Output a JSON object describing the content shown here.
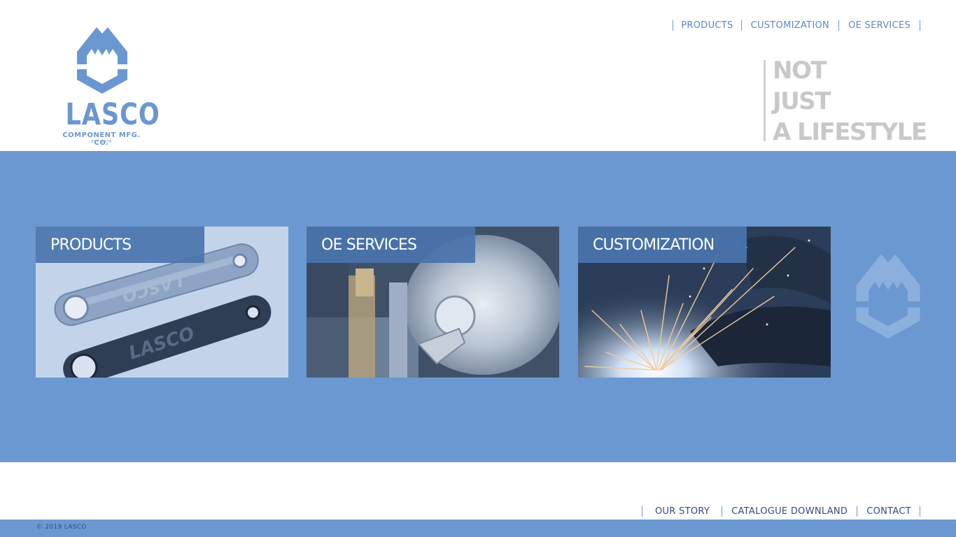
{
  "brand": {
    "name": "LASCO",
    "subtitle": "COMPONENT MFG. CO.",
    "established": "EST. 1978",
    "color_primary": "#6b98d1",
    "color_dark": "#2f4f7d",
    "color_label": "#4a74ad",
    "icon": "lasco-crest-icon"
  },
  "top_nav": {
    "items": [
      "PRODUCTS",
      "CUSTOMIZATION",
      "OE SERVICES"
    ]
  },
  "tagline": {
    "lines": [
      "NOT",
      "JUST",
      "A LIFESTYLE"
    ],
    "color": "#c8c8c8"
  },
  "cards": [
    {
      "label": "PRODUCTS",
      "image": "crank-arms-photo"
    },
    {
      "label": "OE SERVICES",
      "image": "lathe-machining-photo"
    },
    {
      "label": "CUSTOMIZATION",
      "image": "welding-sparks-photo"
    }
  ],
  "footer_nav": {
    "items": [
      "OUR STORY",
      "CATALOGUE DOWNLAND",
      "CONTACT"
    ]
  },
  "copyright": "© 2019 LASCO"
}
